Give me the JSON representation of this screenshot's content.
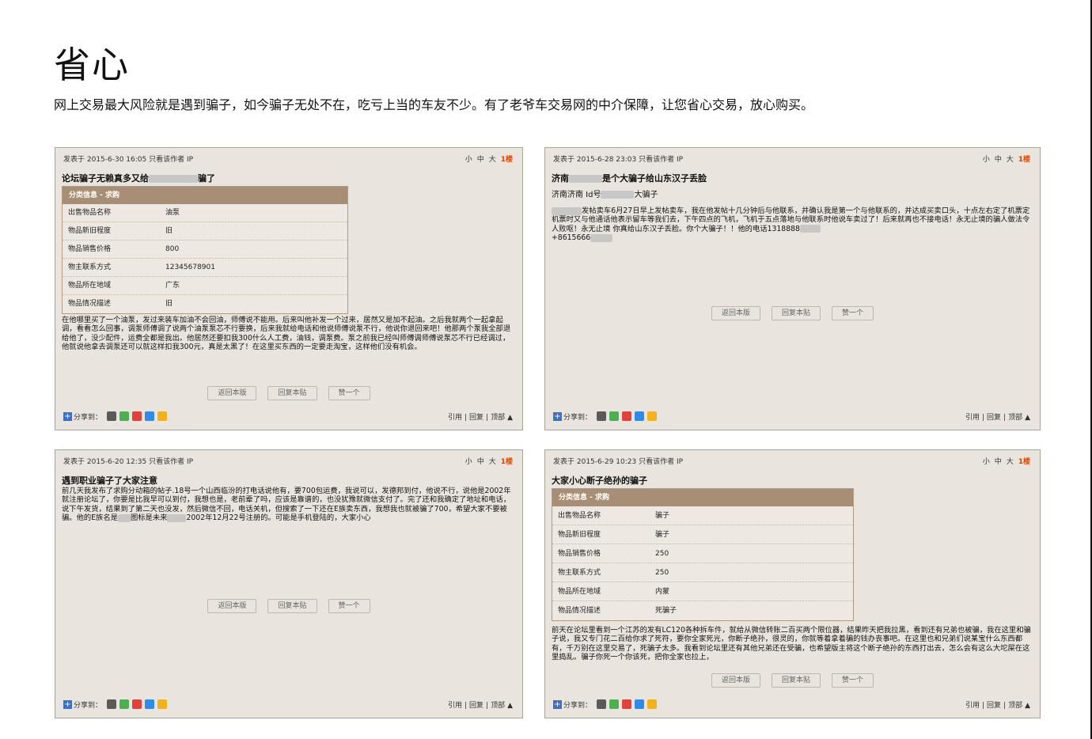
{
  "header": {
    "title": "省心",
    "subtitle": "网上交易最大风险就是遇到骗子，如今骗子无处不在，吃亏上当的车友不少。有了老爷车交易网的中介保障，让您省心交易，放心购买。"
  },
  "common": {
    "font_sizes": [
      "小",
      "中",
      "大"
    ],
    "floor": "1楼",
    "buttons": {
      "back": "返回本版",
      "reply": "回复本贴",
      "like": "赞一个"
    },
    "share_label": "分享到：",
    "share_icons": [
      "tencent-weibo-icon",
      "wechat-icon",
      "sina-weibo-icon",
      "qzone-icon",
      "favorite-icon"
    ],
    "footer_links": [
      "引用",
      "|",
      "回复",
      "|",
      "顶部",
      "▲"
    ],
    "table_header": "分类信息 - 求购"
  },
  "posts": [
    {
      "meta": "发表于 2015-6-30 16:05  只看该作者 IP",
      "title_before": "论坛骗子无赖真多又给",
      "title_after": "骗了",
      "table": [
        {
          "key": "出售物品名称",
          "value": "油泵"
        },
        {
          "key": "物品新旧程度",
          "value": "旧"
        },
        {
          "key": "物品销售价格",
          "value": "800"
        },
        {
          "key": "物主联系方式",
          "value": "12345678901"
        },
        {
          "key": "物品所在地域",
          "value": "广东"
        },
        {
          "key": "物品情况描述",
          "value": "旧"
        }
      ],
      "body": "在他哪里买了一个油泵，发过来装车加油不会回油，师傅说不能用。后来叫他补发一个过来，居然又是加不起油。之后我就两个一起拿起调，看看怎么回事，调泵师傅调了说两个油泵泵芯不行要换，后来我就给电话和他说师傅说泵不行，他说你退回来吧！他那两个泵我全部退给他了，没少配件，运费全都是我出。他居然还要扣我300什么人工费，油钱，调泵费。泵之前我已经叫师傅调师傅说泵芯不行已经调过，他就说他拿去调泵还可以就这样扣我300元，真是太黑了！在这里买东西的一定要走淘宝，这样他们没有机会。"
    },
    {
      "meta": "发表于 2015-6-28 23:03  只看该作者 IP",
      "title_before": "济南",
      "title_after": "是个大骗子给山东汉子丢脸",
      "sub_before": "济南济南 Id号",
      "sub_after": "大骗子",
      "body_after_blur": "发帖卖车6月27日早上发帖卖车，我在他发帖十几分钟后与他联系，并确认我是第一个与他联系的，并达成买卖口头，十点左右定了机票定机票时又与他通话他表示留车等我们去，下午四点的飞机，飞机于五点落地与他联系时他说车卖过了！后来就再也不接电话！永无止境的骗人做法令人败呕！永无止境 你真给山东汉子丢脸。你个大骗子！！他的电话1318888",
      "phone_line": "+8615666"
    },
    {
      "meta": "发表于 2015-6-20 12:35  只看该作者 IP",
      "title": "遇到职业骗子了大家注意",
      "body_part1": "前几天我发布了求购分动箱的帖子.18号一个山西临汾的打电话说他有，要700包运费，我说可以，发德邦到付，他说不行，说他是2002年就注册论坛了，你要是比我早可以到付，我想也是，老前辈了吗，应该是靠谱的，也没犹豫就微信支付了。完了还和我确定了地址和电话，说下午发货，结果到了第二天也没发，然后微信不回，电话关机，但搜索了一下还在E族卖东西，我想我也就被骗了700，希望大家不要被骗。他的E族名是",
      "body_part2": "图标是未来",
      "body_part3": "2002年12月22号注册的。可能是手机登陆的，大家小心"
    },
    {
      "meta": "发表于 2015-6-29 10:23  只看该作者 IP",
      "title": "大家小心断子绝孙的骗子",
      "table": [
        {
          "key": "出售物品名称",
          "value": "骗子"
        },
        {
          "key": "物品新旧程度",
          "value": "骗子"
        },
        {
          "key": "物品销售价格",
          "value": "250"
        },
        {
          "key": "物主联系方式",
          "value": "250"
        },
        {
          "key": "物品所在地域",
          "value": "内蒙"
        },
        {
          "key": "物品情况描述",
          "value": "死骗子"
        }
      ],
      "body": "前天在论坛里看到一个江苏的发有LC120各种拆车件，就给从微信转账二百买两个限位器，结果昨天把我拉黑，看到还有兄弟也被骗，我在这里和骗子说，我又专门花二百给你求了死符，要你全家死光，你断子绝孙，很灵的，你就等着拿着骗的钱办丧事吧。在这里也和兄弟们说某宝什么东西都有，千万别在这里交易了，死骗子太多。我看到论坛里还有其他兄弟还在受骗，也希望版主将这个断子绝孙的东西打出去，怎么会有这么大坨屎在这里捣乱。骗子你死一个你该死，把你全家也拉上，"
    }
  ],
  "colors": {
    "panel_bg": "#e9e5de",
    "table_head": "#a88e74",
    "floor": "#e04400"
  }
}
